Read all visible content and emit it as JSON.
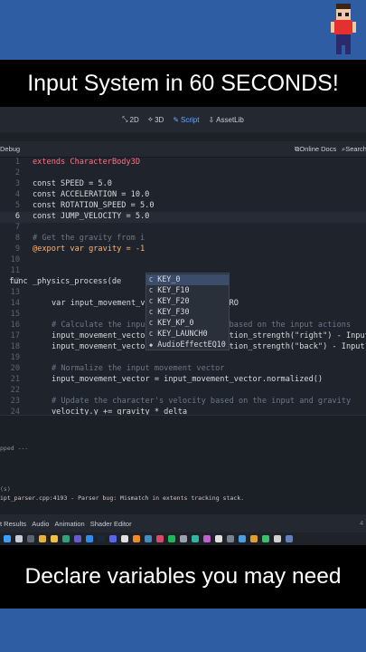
{
  "title": "Input System in 60 SECONDS!",
  "caption": "Declare variables you may need",
  "nav_tabs": [
    {
      "label": "2D",
      "icon": "2d-icon"
    },
    {
      "label": "3D",
      "icon": "3d-icon"
    },
    {
      "label": "Script",
      "icon": "script-icon"
    },
    {
      "label": "AssetLib",
      "icon": "assetlib-icon"
    }
  ],
  "toolbar": {
    "debug_label": "Debug",
    "docs_label": "Online Docs",
    "search_label": "Search"
  },
  "code": {
    "line_numbers": [
      "1",
      "2",
      "3",
      "4",
      "5",
      "6",
      "7",
      "8",
      "9",
      "10",
      "11",
      "12",
      "13",
      "14",
      "15",
      "16",
      "17",
      "18",
      "19",
      "20",
      "21",
      "22",
      "23",
      "24"
    ],
    "lines": {
      "l1": "extends CharacterBody3D",
      "l3": "const SPEED = 5.0",
      "l4": "const ACCELERATION = 10.0",
      "l5": "const ROTATION_SPEED = 5.0",
      "l6": "const JUMP_VELOCITY = 5.0",
      "l8": "# Get the gravity from i",
      "l9": "@export var gravity = -1",
      "l12": "func _physics_process(de",
      "l14": "var input_movement_vector = Vector3.ZERO",
      "l16": "# Calculate the input movement vector based on the input actions",
      "l17": "input_movement_vector.x = Input.get_action_strength(\"right\") - Input",
      "l18": "input_movement_vector.z = Input.get_action_strength(\"back\") - Input",
      "l20": "# Normalize the input movement vector",
      "l21": "input_movement_vector = input_movement_vector.normalized()",
      "l23": "# Update the character's velocity based on the input and gravity",
      "l24": "velocity.y += gravity * delta"
    }
  },
  "autocomplete": {
    "kind_glyph": "C",
    "items": [
      "KEY_0",
      "KEY_F10",
      "KEY_F20",
      "KEY_F30",
      "KEY_KP_0",
      "KEY_LAUNCH0",
      "AudioEffectEQ10"
    ]
  },
  "output": {
    "skipped": "pped ---",
    "s_line": "(s)",
    "error": "ipt_parser.cpp:4193 - Parser bug: Mismatch in extents tracking stack."
  },
  "bottom_tabs": [
    "t Results",
    "Audio",
    "Animation",
    "Shader Editor"
  ],
  "bottom_right": "4",
  "colors": {
    "background": "#2f5da3",
    "editor_bg": "#1f242c",
    "keyword": "#ff7085",
    "type": "#8fffdb",
    "comment": "#6b7687",
    "function": "#57b3ff",
    "string": "#ffeda1"
  },
  "taskbar_icons": [
    "windows-icon",
    "search-icon",
    "files-icon",
    "chrome-icon",
    "folder-icon",
    "edge-icon",
    "store-icon",
    "vscode-icon",
    "steam-icon",
    "discord-icon",
    "obs-icon",
    "blender-icon",
    "godot-icon",
    "paint-icon",
    "spotify-icon",
    "app-icon",
    "app-icon",
    "app-icon",
    "app-icon",
    "app-icon",
    "app-icon",
    "app-icon",
    "app-icon",
    "app-icon",
    "app-icon"
  ]
}
